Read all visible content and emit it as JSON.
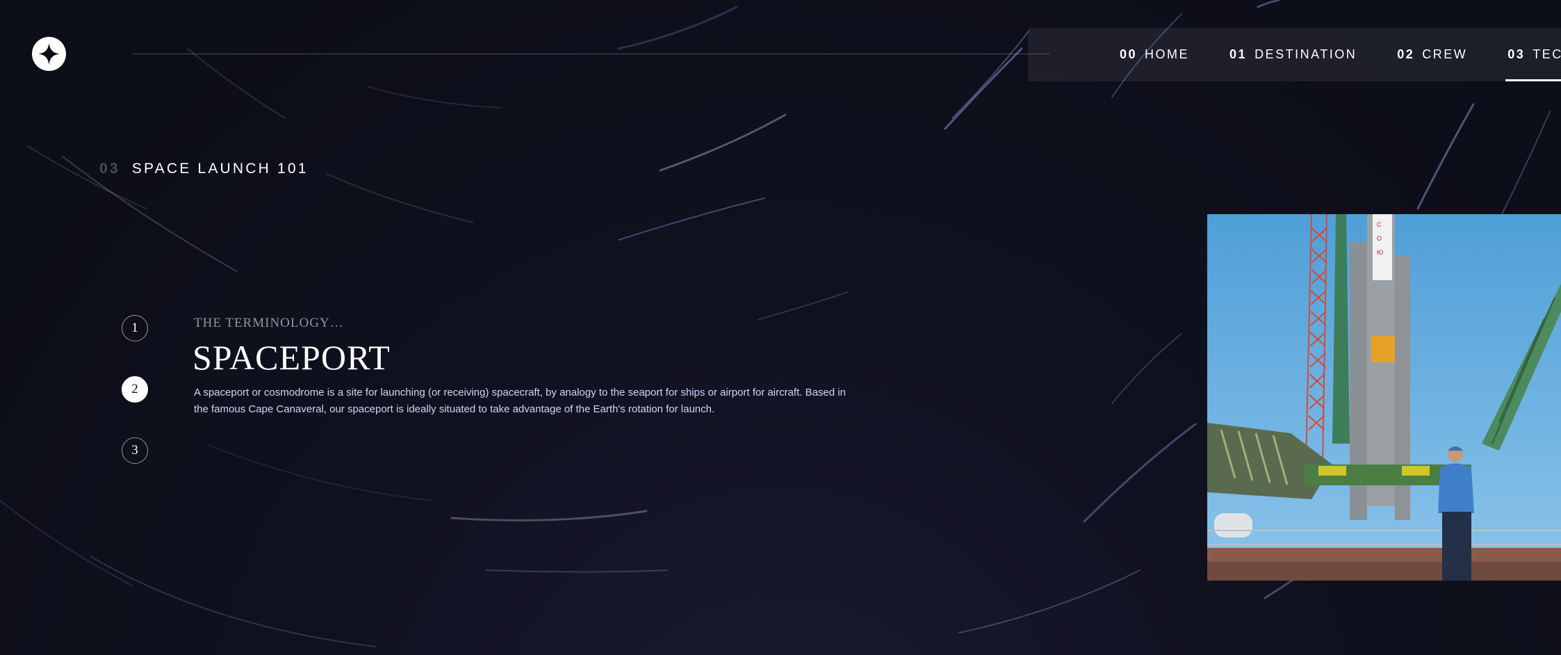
{
  "nav": {
    "items": [
      {
        "num": "00",
        "label": "HOME"
      },
      {
        "num": "01",
        "label": "DESTINATION"
      },
      {
        "num": "02",
        "label": "CREW"
      },
      {
        "num": "03",
        "label": "TECHNOLOGY"
      }
    ],
    "active_index": 3
  },
  "page": {
    "section_num": "03",
    "section_title": "SPACE LAUNCH 101"
  },
  "steps": [
    "1",
    "2",
    "3"
  ],
  "active_step": 2,
  "content": {
    "eyebrow": "THE TERMINOLOGY…",
    "title": "SPACEPORT",
    "description": "A spaceport or cosmodrome is a site for launching (or receiving) spacecraft, by analogy to the seaport for ships or airport for aircraft. Based in the famous Cape Canaveral, our spaceport is ideally situated to take advantage of the Earth's rotation for launch."
  },
  "colors": {
    "background": "#0b0d17",
    "text_light": "#d0d6f9",
    "white": "#ffffff"
  },
  "icons": {
    "logo": "star-logo-icon"
  }
}
